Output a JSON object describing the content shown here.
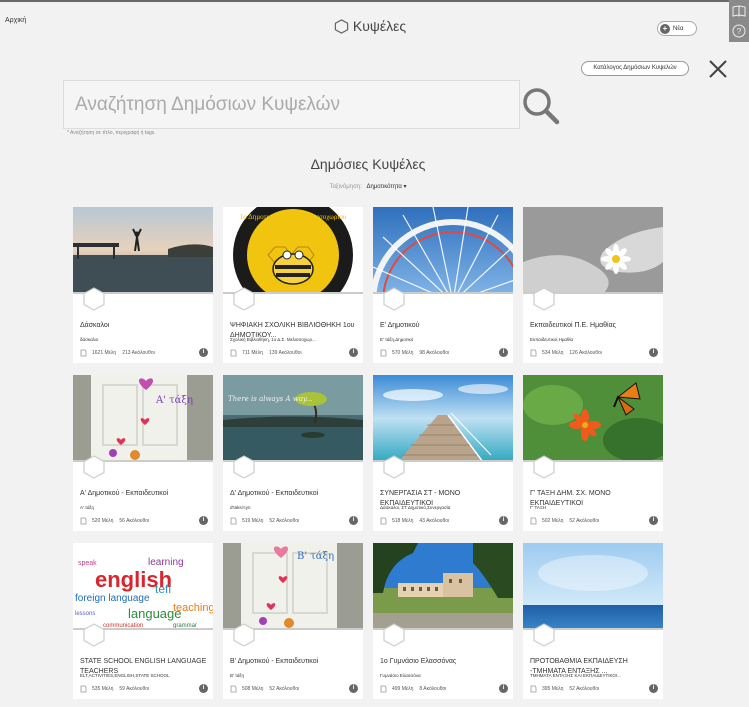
{
  "header": {
    "home_label": "Αρχική",
    "app_title": "Κυψέλες",
    "new_button_label": "Νέα"
  },
  "catalog_button_label": "Κατάλογος Δημόσιων Κυψελών",
  "search": {
    "placeholder": "Αναζήτηση Δημόσιων Κυψελών",
    "hint": "* Αναζήτηση σε τίτλο, περιγραφή ή tags."
  },
  "section": {
    "title": "Δημόσιες Κυψέλες",
    "sort_label": "Ταξινόμηση:",
    "sort_value": "Δημοτικότητα"
  },
  "cards": [
    {
      "title": "Δάσκαλοι",
      "subtitle": "δάσκαλοι",
      "members": "1621 Μέλη",
      "followers": "213 Ακόλουθοι",
      "image": "sunset-lake"
    },
    {
      "title": "ΨΗΦΙΑΚΗ ΣΧΟΛΙΚΗ ΒΙΒΛΙΟΘΗΚΗ 1ου ΔΗΜΟΤΙΚΟΥ...",
      "subtitle": "Σχολική Βιβλιοθήκη, 1ο Δ.Σ. Μελισσοχωρ...",
      "members": "711 Μέλη",
      "followers": "139 Ακόλουθοι",
      "image": "bee-logo"
    },
    {
      "title": "Ε' Δημοτικού",
      "subtitle": "Ε' τάξη,Δημοτικό",
      "members": "570 Μέλη",
      "followers": "98 Ακόλουθοι",
      "image": "ferris-wheel"
    },
    {
      "title": "Εκπαιδευτικοί Π.Ε. Ημαθίας",
      "subtitle": "Εκπαιδευτικοί,Ημαθία",
      "members": "534 Μέλη",
      "followers": "126 Ακόλουθοι",
      "image": "hands-flower"
    },
    {
      "title": "Α' Δημοτικού - Εκπαιδευτικοί",
      "subtitle": "Α' τάξη",
      "members": "520 Μέλη",
      "followers": "56 Ακόλουθοι",
      "image": "door-a"
    },
    {
      "title": "Δ' Δημοτικού - Εκπαιδευτικοί",
      "subtitle": "d'taksi'сyn",
      "members": "519 Μέλη",
      "followers": "52 Ακόλουθοι",
      "image": "tree-lake"
    },
    {
      "title": "ΣΥΝΕΡΓΑΣΙΑ ΣΤ - ΜΟΝΟ ΕΚΠΑΙΔΕΥΤΙΚΟΙ",
      "subtitle": "Δάσκαλοι, ΣΤ Δημοτικό,Συνεργασία",
      "members": "518 Μέλη",
      "followers": "43 Ακόλουθοι",
      "image": "pier"
    },
    {
      "title": "Γ' ΤΑΞΗ ΔΗΜ. ΣΧ. ΜΟΝΟ ΕΚΠΑΙΔΕΥΤΙΚΟΙ",
      "subtitle": "Γ' ΤΑΞΗ",
      "members": "502 Μέλη",
      "followers": "52 Ακόλουθοι",
      "image": "butterfly"
    },
    {
      "title": "STATE SCHOOL ENGLISH LANGUAGE TEACHERS",
      "subtitle": "ELT,ACTIVITIES,ENGLISH,STATE SCHOOL",
      "members": "535 Μέλη",
      "followers": "59 Ακόλουθοι",
      "image": "english-cloud"
    },
    {
      "title": "Β' Δημοτικού - Εκπαιδευτικοί",
      "subtitle": "Β' τάξη",
      "members": "508 Μέλη",
      "followers": "52 Ακόλουθοι",
      "image": "door-b"
    },
    {
      "title": "1ο Γυμνάσιο Ελασσόνας",
      "subtitle": "Γυμνάσιο Ελασσόνα",
      "members": "499 Μέλη",
      "followers": "8 Ακόλουθοι",
      "image": "school"
    },
    {
      "title": "ΠΡΟΤΟΒΑΘΜΙΑ ΕΚΠΑΙΔΕΥΣΗ -ΤΜΗΜΑΤΑ ΕΝΤΑΞΗΣ ...",
      "subtitle": "ΤΜΗΜΑΤΑ ΕΝΤΑΞΗΣ ΚΑΙ ΕΚΠΑΙΔΕΥΤΙΚΟΙ...",
      "members": "395 Μέλη",
      "followers": "52 Ακόλουθοι",
      "image": "sea"
    }
  ],
  "image_texts": {
    "bee_logo_text": "1ο Δημοτικό Σχολείο Μελισσοχωρίου",
    "tree_lake_text": "There is always A way...",
    "door_a_text": "Α' τάξη",
    "door_b_text": "Β' τάξη",
    "english_words": [
      "english",
      "learning",
      "foreign language",
      "teaching",
      "language",
      "tefl",
      "speak",
      "lessons",
      "communication",
      "grammar"
    ]
  }
}
